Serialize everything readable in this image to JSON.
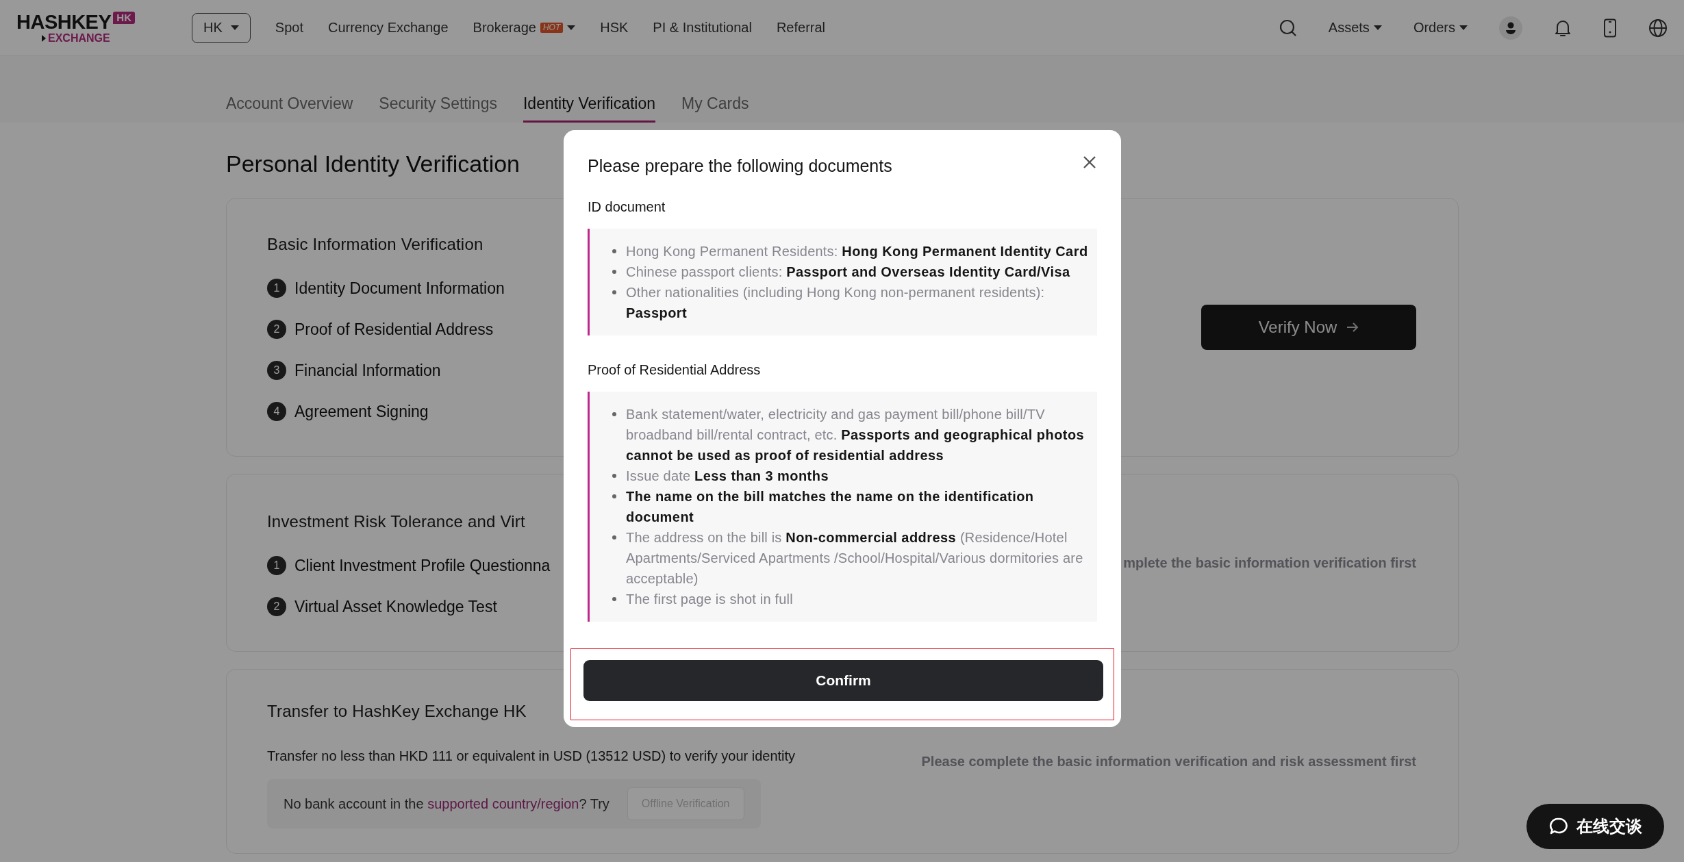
{
  "header": {
    "logo": {
      "wordmark": "HASHKEY",
      "badge": "HK",
      "subtitle": "EXCHANGE"
    },
    "region_select": {
      "value": "HK"
    },
    "nav": [
      {
        "label": "Spot",
        "dropdown": false
      },
      {
        "label": "Currency Exchange",
        "dropdown": false
      },
      {
        "label": "Brokerage",
        "badge": "HOT",
        "dropdown": true
      },
      {
        "label": "HSK",
        "dropdown": false
      },
      {
        "label": "PI & Institutional",
        "dropdown": false
      },
      {
        "label": "Referral",
        "dropdown": false
      }
    ],
    "menus": [
      {
        "label": "Assets"
      },
      {
        "label": "Orders"
      }
    ]
  },
  "tabs": [
    {
      "label": "Account Overview",
      "selected": false
    },
    {
      "label": "Security Settings",
      "selected": false
    },
    {
      "label": "Identity Verification",
      "selected": true
    },
    {
      "label": "My Cards",
      "selected": false
    }
  ],
  "page_title": "Personal Identity Verification",
  "sections": [
    {
      "title": "Basic Information Verification",
      "steps": [
        {
          "number": "1",
          "label": "Identity Document Information"
        },
        {
          "number": "2",
          "label": "Proof of Residential Address"
        },
        {
          "number": "3",
          "label": "Financial Information"
        },
        {
          "number": "4",
          "label": "Agreement Signing"
        }
      ],
      "action": {
        "kind": "button",
        "label": "Verify Now"
      }
    },
    {
      "title": "Investment Risk Tolerance and Virt",
      "steps": [
        {
          "number": "1",
          "label": "Client Investment Profile Questionna"
        },
        {
          "number": "2",
          "label": "Virtual Asset Knowledge Test"
        }
      ],
      "action": {
        "kind": "note",
        "text": "mplete the basic information verification first"
      }
    },
    {
      "title": "Transfer to HashKey Exchange HK",
      "description": "Transfer no less than HKD 111 or equivalent in USD (13512 USD) to verify your identity",
      "notice": {
        "before": "No bank account in the ",
        "link": "supported country/region",
        "after": "? Try",
        "button": {
          "label": "Offline Verification",
          "disabled": true
        }
      },
      "action": {
        "kind": "note",
        "text": "Please complete the basic information verification and risk assessment first"
      }
    }
  ],
  "modal": {
    "title": "Please prepare the following documents",
    "highlighted": true,
    "confirm_label": "Confirm",
    "groups": [
      {
        "heading": "ID document",
        "items": [
          {
            "text": "Hong Kong Permanent Residents: **Hong Kong Permanent Identity Card**"
          },
          {
            "text": "Chinese passport clients: **Passport and Overseas Identity Card/Visa**"
          },
          {
            "text": "Other nationalities (including Hong Kong non-permanent residents): **Passport**"
          }
        ]
      },
      {
        "heading": "Proof of Residential Address",
        "items": [
          {
            "text": "Bank statement/water, electricity and gas payment bill/phone bill/TV broadband bill/rental contract, etc. **Passports and geographical photos cannot be used as proof of residential address**"
          },
          {
            "text": "Issue date **Less than 3 months**"
          },
          {
            "text": "**The name on the bill matches the name on the identification document**"
          },
          {
            "text": "The address on the bill is **Non-commercial address** (Residence/Hotel Apartments/Serviced Apartments /School/Hospital/Various dormitories are acceptable)"
          },
          {
            "text": "The first page is shot in full"
          }
        ]
      }
    ]
  },
  "chat_button": {
    "label": "在线交谈"
  }
}
